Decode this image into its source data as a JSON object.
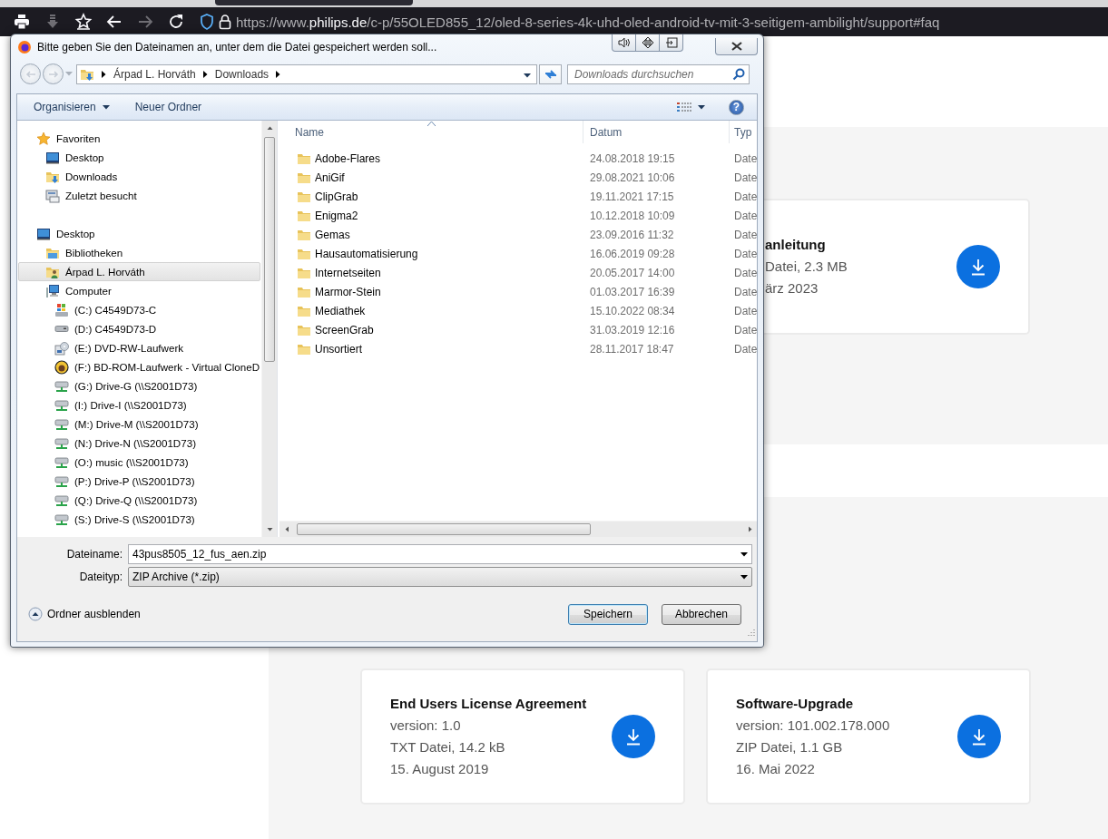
{
  "browser": {
    "toolbar_buttons": [
      {
        "kind": "print",
        "disabled": false
      },
      {
        "kind": "download",
        "disabled": true
      },
      {
        "kind": "bookmark",
        "disabled": false
      },
      {
        "kind": "back",
        "disabled": false
      },
      {
        "kind": "forward",
        "disabled": true
      },
      {
        "kind": "reload",
        "disabled": false
      }
    ],
    "url": {
      "prefix": "https://www.",
      "domain": "philips.de",
      "path": "/c-p/55OLED855_12/oled-8-series-4k-uhd-oled-android-tv-mit-3-seitigem-ambilight/support#faq"
    }
  },
  "page": {
    "cards": [
      {
        "title": "anleitung",
        "lines": [
          "Datei, 2.3 MB",
          "ärz 2023"
        ]
      },
      {
        "title": "End Users License Agreement",
        "lines": [
          "version: 1.0",
          "TXT Datei, 14.2 kB",
          "15. August 2019"
        ]
      },
      {
        "title": "Software-Upgrade",
        "lines": [
          "version: 101.002.178.000",
          "ZIP Datei, 1.1 GB",
          "16. Mai 2022"
        ]
      }
    ]
  },
  "dialog": {
    "title": "Bitte geben Sie den Dateinamen an, unter dem die Datei gespeichert werden soll...",
    "breadcrumb": [
      "Árpad L. Horváth",
      "Downloads"
    ],
    "search": {
      "placeholder": "Downloads durchsuchen"
    },
    "toolbar": {
      "organize": "Organisieren",
      "new_folder": "Neuer Ordner",
      "help": "?"
    },
    "nav": [
      {
        "label": "Favoriten",
        "kind": "favorites",
        "selected": false,
        "children": [
          {
            "label": "Desktop",
            "kind": "desktop",
            "selected": false
          },
          {
            "label": "Downloads",
            "kind": "downloads",
            "selected": false
          },
          {
            "label": "Zuletzt besucht",
            "kind": "recent",
            "selected": false
          }
        ]
      },
      {
        "label": "Desktop",
        "kind": "desktop",
        "selected": false,
        "children": [
          {
            "label": "Bibliotheken",
            "kind": "library",
            "selected": false
          },
          {
            "label": "Árpad L. Horváth",
            "kind": "user",
            "selected": true
          },
          {
            "label": "Computer",
            "kind": "computer",
            "selected": false,
            "children": [
              {
                "label": "(C:) C4549D73-C",
                "kind": "system-drive",
                "selected": false
              },
              {
                "label": "(D:) C4549D73-D",
                "kind": "drive",
                "selected": false
              },
              {
                "label": "(E:) DVD-RW-Laufwerk",
                "kind": "optical-drive",
                "selected": false
              },
              {
                "label": "(F:) BD-ROM-Laufwerk - Virtual CloneD",
                "kind": "virtual-drive",
                "selected": false
              },
              {
                "label": "(G:) Drive-G (\\\\S2001D73)",
                "kind": "network-drive",
                "selected": false
              },
              {
                "label": "(I:) Drive-I (\\\\S2001D73)",
                "kind": "network-drive",
                "selected": false
              },
              {
                "label": "(M:) Drive-M (\\\\S2001D73)",
                "kind": "network-drive",
                "selected": false
              },
              {
                "label": "(N:) Drive-N (\\\\S2001D73)",
                "kind": "network-drive",
                "selected": false
              },
              {
                "label": "(O:) music (\\\\S2001D73)",
                "kind": "network-drive",
                "selected": false
              },
              {
                "label": "(P:) Drive-P (\\\\S2001D73)",
                "kind": "network-drive",
                "selected": false
              },
              {
                "label": "(Q:) Drive-Q (\\\\S2001D73)",
                "kind": "network-drive",
                "selected": false
              },
              {
                "label": "(S:) Drive-S (\\\\S2001D73)",
                "kind": "network-drive",
                "selected": false
              }
            ]
          }
        ]
      }
    ],
    "columns": [
      {
        "label": "Name",
        "sorted": true
      },
      {
        "label": "Datum",
        "sorted": false
      },
      {
        "label": "Typ",
        "sorted": false
      }
    ],
    "files": [
      {
        "name": "Adobe-Flares",
        "date": "24.08.2018 19:15",
        "column_3": "Date",
        "selected": false
      },
      {
        "name": "AniGif",
        "date": "29.08.2021 10:06",
        "column_3": "Date",
        "selected": false
      },
      {
        "name": "ClipGrab",
        "date": "19.11.2021 17:15",
        "column_3": "Date",
        "selected": false
      },
      {
        "name": "Enigma2",
        "date": "10.12.2018 10:09",
        "column_3": "Date",
        "selected": false
      },
      {
        "name": "Gemas",
        "date": "23.09.2016 11:32",
        "column_3": "Date",
        "selected": false
      },
      {
        "name": "Hausautomatisierung",
        "date": "16.06.2019 09:28",
        "column_3": "Date",
        "selected": false
      },
      {
        "name": "Internetseiten",
        "date": "20.05.2017 14:00",
        "column_3": "Date",
        "selected": false
      },
      {
        "name": "Marmor-Stein",
        "date": "01.03.2017 16:39",
        "column_3": "Date",
        "selected": false
      },
      {
        "name": "Mediathek",
        "date": "15.10.2022 08:34",
        "column_3": "Date",
        "selected": false
      },
      {
        "name": "ScreenGrab",
        "date": "31.03.2019 12:16",
        "column_3": "Date",
        "selected": false
      },
      {
        "name": "Unsortiert",
        "date": "28.11.2017 18:47",
        "column_3": "Date",
        "selected": false
      }
    ],
    "file_name": {
      "label": "Dateiname:",
      "value": "43pus8505_12_fus_aen.zip"
    },
    "file_type": {
      "label": "Dateityp:",
      "value": "ZIP Archive (*.zip)"
    },
    "hide_folders": "Ordner ausblenden",
    "buttons": [
      {
        "label": "Speichern",
        "default": true
      },
      {
        "label": "Abbrechen",
        "default": false
      }
    ]
  }
}
